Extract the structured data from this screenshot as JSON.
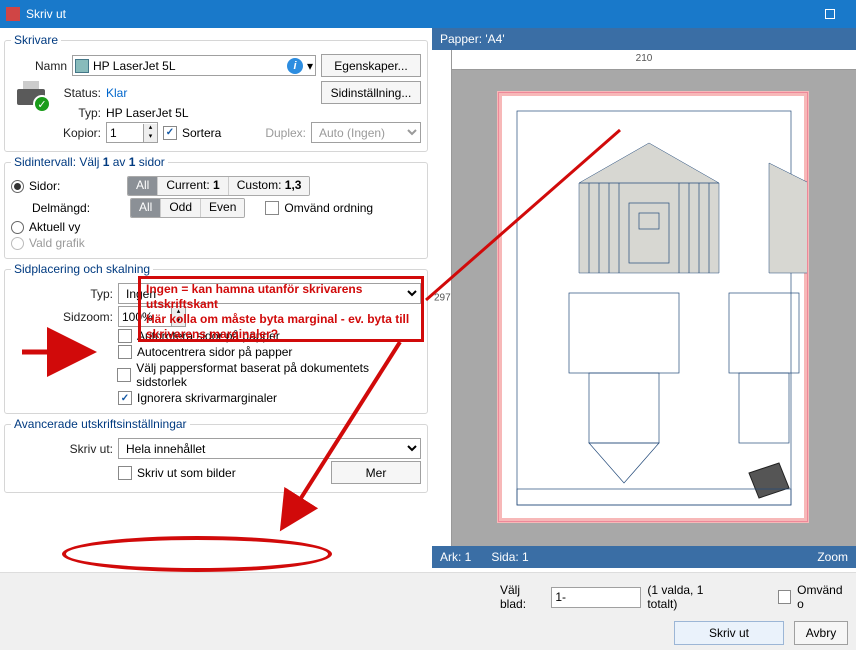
{
  "title": "Skriv ut",
  "printer_section": {
    "legend": "Skrivare",
    "name_label": "Namn",
    "name_value": "HP LaserJet 5L",
    "properties_btn": "Egenskaper...",
    "status_label": "Status:",
    "status_value": "Klar",
    "page_setup_btn": "Sidinställning...",
    "type_label": "Typ:",
    "type_value": "HP LaserJet 5L",
    "copies_label": "Kopior:",
    "copies_value": "1",
    "collate_label": "Sortera",
    "duplex_label": "Duplex:",
    "duplex_value": "Auto (Ingen)"
  },
  "range_section": {
    "legend_prefix": "Sidintervall: Välj ",
    "legend_mid": "1",
    "legend_mid2": " av ",
    "legend_end": "1",
    "legend_suffix": " sidor",
    "pages_label": "Sidor:",
    "seg_all": "All",
    "seg_current": "Current:",
    "seg_current_v": "1",
    "seg_custom": "Custom:",
    "seg_custom_v": "1,3",
    "subset_label": "Delmängd:",
    "sub_all": "All",
    "sub_odd": "Odd",
    "sub_even": "Even",
    "reverse_label": "Omvänd ordning",
    "current_view": "Aktuell vy",
    "sel_graphic": "Vald grafik"
  },
  "placement_section": {
    "legend": "Sidplacering och skalning",
    "type_label": "Typ:",
    "type_value": "Ingen",
    "zoom_label": "Sidzoom:",
    "zoom_value": "100%",
    "autorotate": "Autorotera sidor på papper",
    "autocenter": "Autocentrera sidor på papper",
    "paperformat": "Välj pappersformat baserat på dokumentets sidstorlek",
    "ignoremargins": "Ignorera skrivarmarginaler"
  },
  "advanced_section": {
    "legend": "Avancerade utskriftsinställningar",
    "print_label": "Skriv ut:",
    "print_value": "Hela innehållet",
    "as_images": "Skriv ut som bilder",
    "more_btn": "Mer"
  },
  "preview": {
    "paper_label": "Papper: 'A4'",
    "w": "210",
    "h": "297",
    "ark": "Ark: 1",
    "sida": "Sida: 1",
    "zoom": "Zoom"
  },
  "footer": {
    "select_sheet": "Välj blad:",
    "select_value": "1-",
    "select_info": "(1 valda, 1 totalt)",
    "reverse": "Omvänd o",
    "print_btn": "Skriv ut",
    "cancel_btn": "Avbry"
  },
  "annotation": {
    "line1": "Ingen = kan hamna utanför skrivarens",
    "line2": "utskriftskant",
    "line3": "Här kolla om måste byta marginal - ev. byta till",
    "line4": "skrivarens marginaler?"
  }
}
